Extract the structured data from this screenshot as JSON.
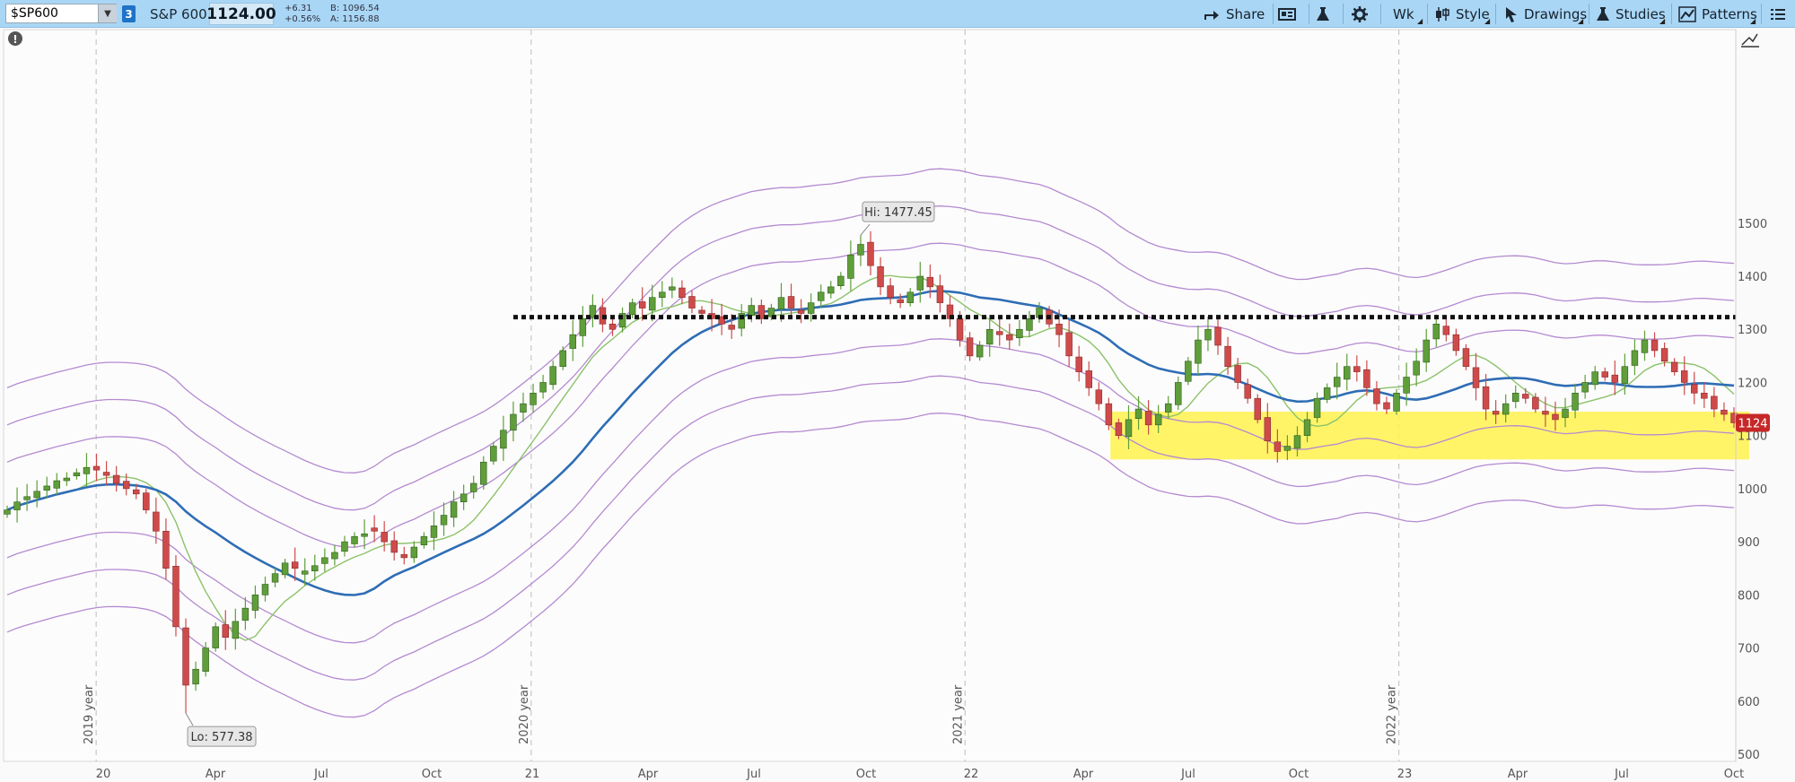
{
  "toolbar": {
    "symbol": "$SP600",
    "link_number": "3",
    "symbol_name": "S&P 600",
    "last_price": "1124.00",
    "change": "+6.31",
    "change_pct": "+0.56%",
    "bid": "B: 1096.54",
    "ask": "A: 1156.88",
    "share_label": "Share",
    "timeframe_label": "Wk",
    "style_label": "Style",
    "drawings_label": "Drawings",
    "studies_label": "Studies",
    "patterns_label": "Patterns"
  },
  "colors": {
    "toolbar_bg": "#a9d6f5",
    "bull": "#5f9e3a",
    "bear": "#cf4b4b",
    "ma_blue": "#2f6db5",
    "ma_green": "#8cc26a",
    "envelope": "#b48ad1",
    "highlight": "#fff24d",
    "price_tag": "#c62828"
  },
  "chart_data": {
    "type": "candlestick",
    "symbol": "$SP600",
    "interval": "Wk",
    "ylim": [
      500,
      1520
    ],
    "y_ticks": [
      500,
      600,
      700,
      800,
      900,
      1000,
      1100,
      1200,
      1300,
      1400,
      1500
    ],
    "x_tick_labels": [
      "20",
      "Apr",
      "Jul",
      "Oct",
      "21",
      "Apr",
      "Jul",
      "Oct",
      "22",
      "Apr",
      "Jul",
      "Oct",
      "23",
      "Apr",
      "Jul",
      "Oct"
    ],
    "year_labels": [
      "2019 year",
      "2020 year",
      "2021 year",
      "2022 year"
    ],
    "annotations": {
      "high_label": "Hi: 1477.45",
      "high_value": 1477.45,
      "low_label": "Lo: 577.38",
      "low_value": 577.38,
      "resistance_level": 1323,
      "support_zone": [
        1055,
        1145
      ],
      "last_price_tag": "1124",
      "last_price": 1124
    },
    "closes": [
      960,
      975,
      985,
      995,
      1005,
      1015,
      1020,
      1030,
      1040,
      1035,
      1025,
      1010,
      1000,
      990,
      960,
      920,
      850,
      740,
      630,
      660,
      700,
      740,
      720,
      750,
      775,
      800,
      820,
      840,
      860,
      850,
      845,
      855,
      870,
      880,
      900,
      910,
      915,
      920,
      900,
      880,
      870,
      890,
      910,
      930,
      950,
      975,
      990,
      1010,
      1050,
      1080,
      1110,
      1140,
      1160,
      1180,
      1200,
      1230,
      1260,
      1290,
      1320,
      1345,
      1310,
      1300,
      1330,
      1350,
      1340,
      1360,
      1370,
      1380,
      1360,
      1340,
      1330,
      1320,
      1310,
      1300,
      1330,
      1345,
      1320,
      1340,
      1360,
      1340,
      1330,
      1350,
      1370,
      1380,
      1400,
      1440,
      1460,
      1420,
      1380,
      1360,
      1350,
      1370,
      1400,
      1380,
      1350,
      1320,
      1280,
      1250,
      1270,
      1300,
      1290,
      1280,
      1300,
      1320,
      1340,
      1310,
      1290,
      1250,
      1220,
      1190,
      1160,
      1120,
      1100,
      1130,
      1150,
      1120,
      1140,
      1160,
      1200,
      1240,
      1280,
      1300,
      1270,
      1230,
      1200,
      1170,
      1130,
      1090,
      1070,
      1080,
      1100,
      1130,
      1170,
      1190,
      1210,
      1230,
      1220,
      1190,
      1160,
      1150,
      1180,
      1210,
      1240,
      1280,
      1310,
      1290,
      1260,
      1230,
      1190,
      1150,
      1140,
      1160,
      1180,
      1170,
      1150,
      1140,
      1130,
      1150,
      1180,
      1200,
      1220,
      1210,
      1200,
      1230,
      1260,
      1280,
      1260,
      1240,
      1220,
      1200,
      1180,
      1170,
      1150,
      1140,
      1124
    ]
  }
}
